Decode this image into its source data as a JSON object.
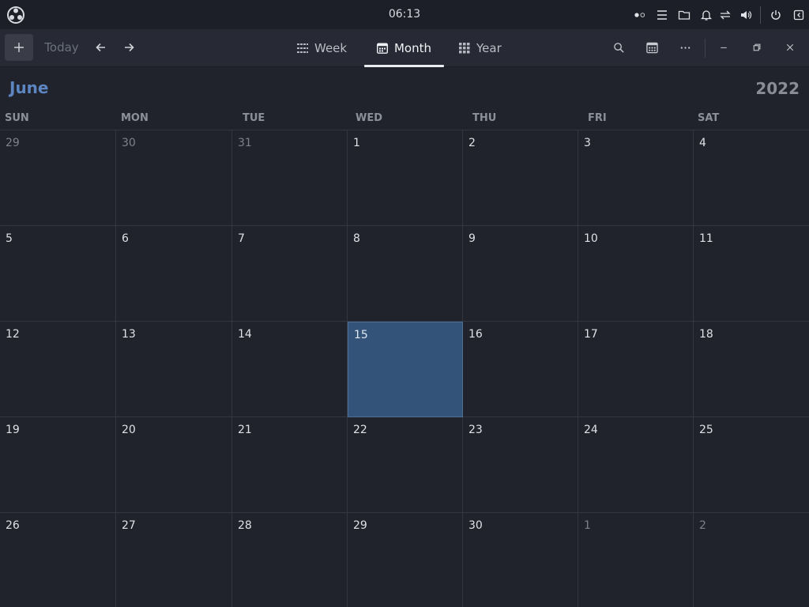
{
  "system_panel": {
    "clock": "06:13",
    "logo_icon": "app-menu-logo-icon",
    "tray_icons": [
      "toggle-dots-icon",
      "menu-lines-icon",
      "folder-icon",
      "bell-icon",
      "network-transfer-icon",
      "volume-icon",
      "power-icon",
      "panel-exit-icon"
    ]
  },
  "toolbar": {
    "new_event_icon": "plus-icon",
    "today_label": "Today",
    "prev_icon": "arrow-left-icon",
    "next_icon": "arrow-right-icon",
    "views": [
      {
        "label": "Week",
        "icon": "week-grid-icon",
        "active": false
      },
      {
        "label": "Month",
        "icon": "month-calendar-icon",
        "active": true
      },
      {
        "label": "Year",
        "icon": "year-grid-icon",
        "active": false
      }
    ],
    "search_icon": "search-icon",
    "calendars_icon": "calendar-list-icon",
    "more_icon": "more-dots-icon",
    "minimize_icon": "minimize-icon",
    "restore_icon": "restore-icon",
    "close_icon": "close-icon"
  },
  "calendar": {
    "month": "June",
    "year": "2022",
    "weekdays": [
      "SUN",
      "MON",
      "TUE",
      "WED",
      "THU",
      "FRI",
      "SAT"
    ],
    "weeks": [
      [
        {
          "day": "29",
          "outside": true
        },
        {
          "day": "30",
          "outside": true
        },
        {
          "day": "31",
          "outside": true
        },
        {
          "day": "1"
        },
        {
          "day": "2"
        },
        {
          "day": "3"
        },
        {
          "day": "4"
        }
      ],
      [
        {
          "day": "5"
        },
        {
          "day": "6"
        },
        {
          "day": "7"
        },
        {
          "day": "8"
        },
        {
          "day": "9"
        },
        {
          "day": "10"
        },
        {
          "day": "11"
        }
      ],
      [
        {
          "day": "12"
        },
        {
          "day": "13"
        },
        {
          "day": "14"
        },
        {
          "day": "15",
          "selected": true
        },
        {
          "day": "16"
        },
        {
          "day": "17"
        },
        {
          "day": "18"
        }
      ],
      [
        {
          "day": "19"
        },
        {
          "day": "20"
        },
        {
          "day": "21"
        },
        {
          "day": "22"
        },
        {
          "day": "23"
        },
        {
          "day": "24"
        },
        {
          "day": "25"
        }
      ],
      [
        {
          "day": "26"
        },
        {
          "day": "27"
        },
        {
          "day": "28"
        },
        {
          "day": "29"
        },
        {
          "day": "30"
        },
        {
          "day": "1",
          "outside": true
        },
        {
          "day": "2",
          "outside": true
        }
      ]
    ]
  },
  "colors": {
    "background": "#20222c",
    "month_accent": "#5d86c1",
    "selected_day": "#335478"
  }
}
